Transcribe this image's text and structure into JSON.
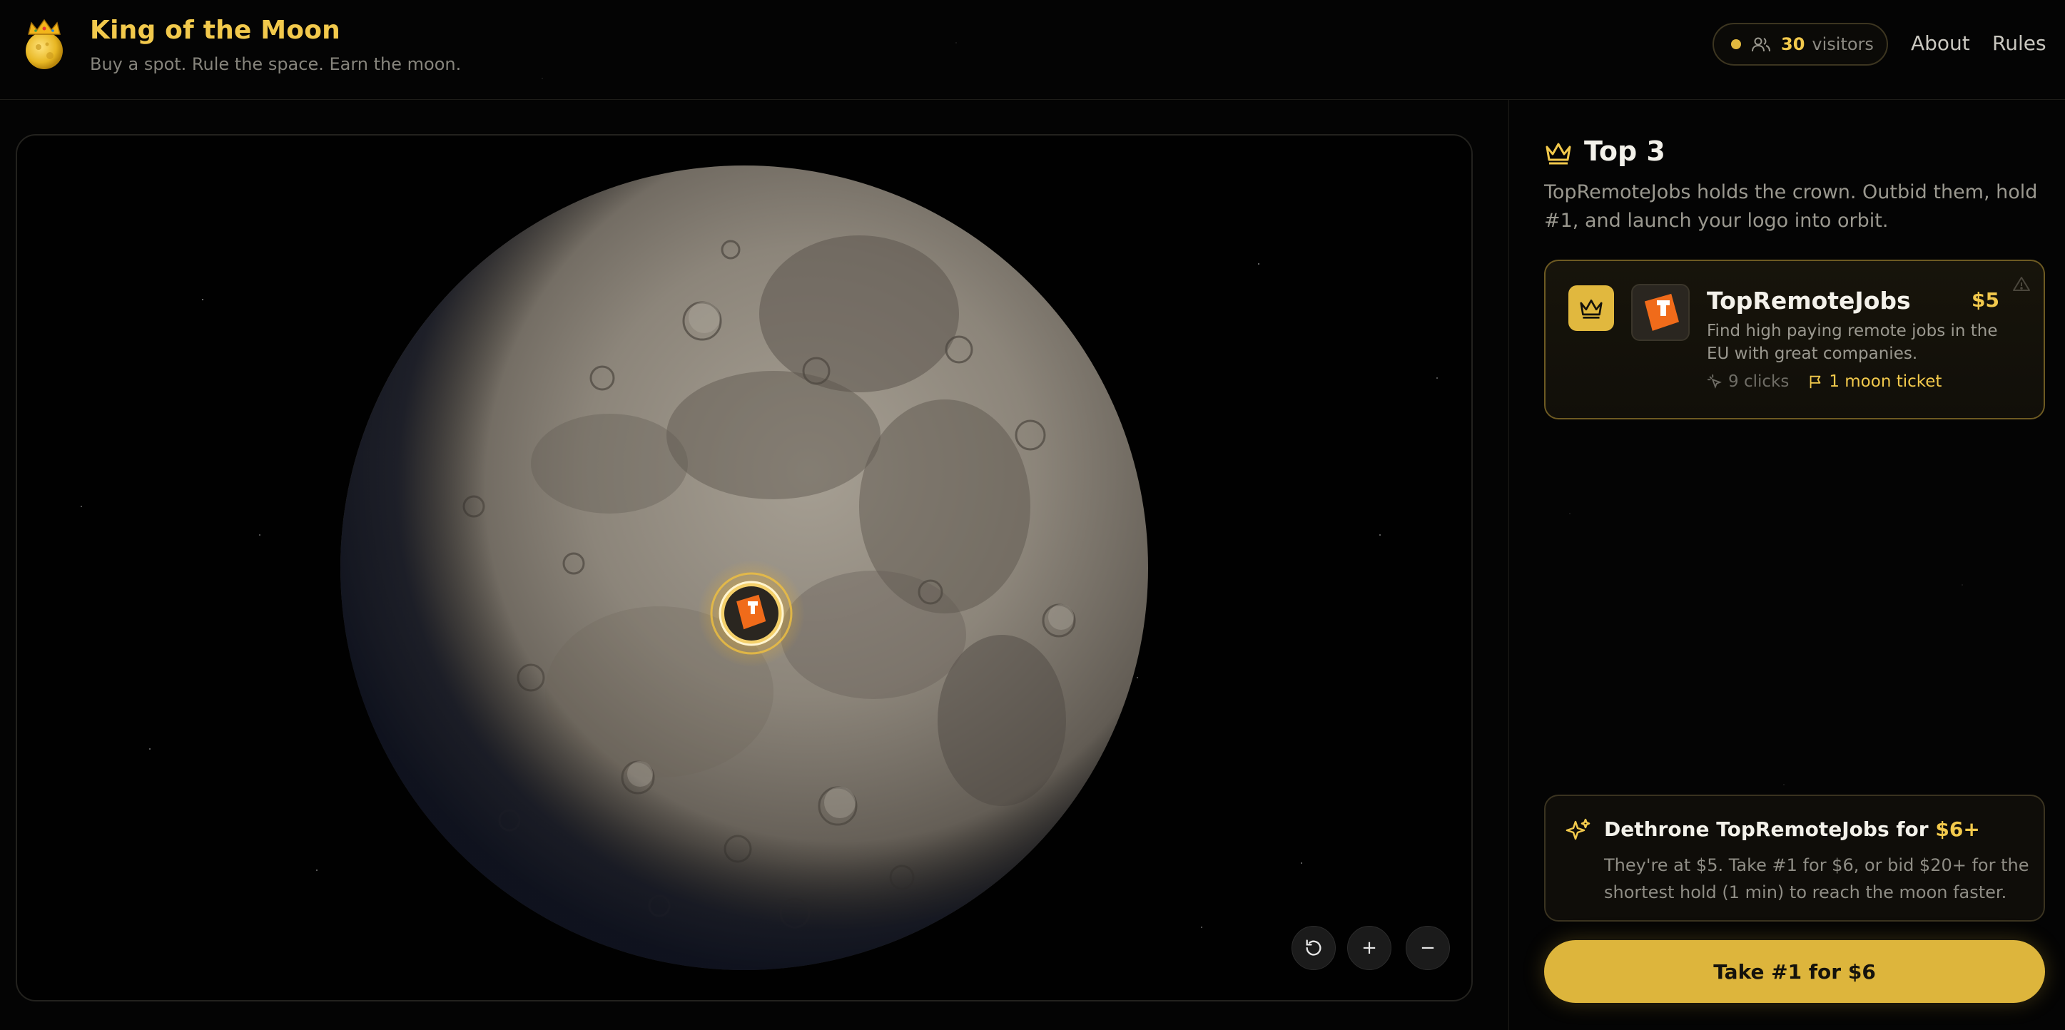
{
  "header": {
    "title": "King of the Moon",
    "tagline": "Buy a spot. Rule the space. Earn the moon.",
    "visitors_count": "30",
    "visitors_label": "visitors",
    "nav": [
      {
        "label": "About"
      },
      {
        "label": "Rules"
      }
    ]
  },
  "map": {
    "marker_logo": "T",
    "controls": [
      "reset-view-icon",
      "zoom-in-icon",
      "zoom-out-icon"
    ],
    "zoom_in_label": "+",
    "zoom_out_label": "−"
  },
  "sidebar": {
    "title": "Top 3",
    "description": "TopRemoteJobs holds the crown. Outbid them, hold #1, and launch your logo into orbit.",
    "leaders": [
      {
        "name": "TopRemoteJobs",
        "price": "$5",
        "description": "Find high paying remote jobs in the EU with great companies.",
        "clicks": "9 clicks",
        "tickets": "1 moon ticket",
        "logo_letter": "T"
      }
    ],
    "dethrone": {
      "title_prefix": "Dethrone TopRemoteJobs for ",
      "title_amount": "$6+",
      "body": "They're at $5. Take #1 for $6, or bid $20+ for the shortest hold (1 min) to reach the moon faster."
    },
    "cta_label": "Take #1 for $6"
  },
  "colors": {
    "accent": "#f2c94c",
    "button": "#ddb53c",
    "background": "#050505",
    "brand_orange": "#f06b1a"
  }
}
